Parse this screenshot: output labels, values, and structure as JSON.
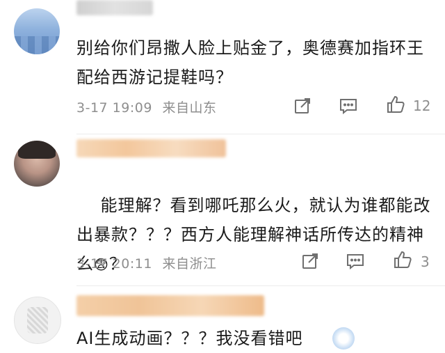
{
  "comments": [
    {
      "username": "",
      "text": "别给你们昂撒人脸上贴金了，奥德赛加指环王配给西游记提鞋吗？",
      "time": "3-17 19:09",
      "location": "来自山东",
      "likes": "12",
      "icons": [
        "share-icon",
        "comment-icon",
        "like-icon"
      ]
    },
    {
      "username": "",
      "text": "能理解？看到哪吒那么火，就认为谁都能改出暴款？？？西方人能理解神话所传达的精神么",
      "emoji": "😨",
      "text_end": "？",
      "time": "3-17 20:11",
      "location": "来自浙江",
      "likes": "3",
      "icons": [
        "share-icon",
        "comment-icon",
        "like-icon"
      ]
    },
    {
      "username": "",
      "text": "AI生成动画？？？我没看错吧"
    }
  ],
  "colors": {
    "meta_text": "#8e8e8e",
    "body_text": "#1a1a1a",
    "divider": "#ececec"
  }
}
